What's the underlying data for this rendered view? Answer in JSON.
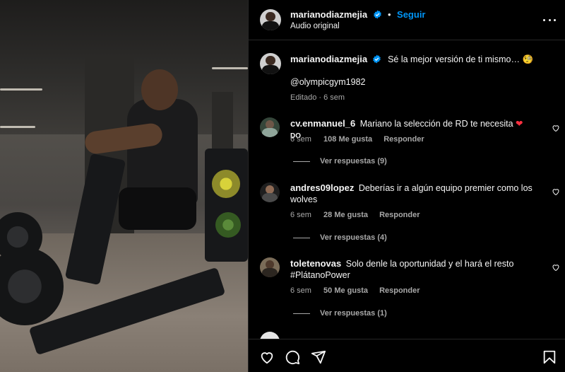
{
  "post": {
    "author": "marianodiazmejia",
    "follow_label": "Seguir",
    "separator": "•",
    "audio": "Audio original",
    "caption_author": "marianodiazmejia",
    "caption": "Sé la mejor versión de ti mismo…",
    "caption_emoji": "🧐",
    "mention": "@olympicgym1982",
    "edited": "Editado · 6 sem"
  },
  "comments": [
    {
      "user": "cv.enmanuel_6",
      "text": "Mariano la selección de RD te necesita",
      "text_suffix": "DO",
      "time": "6 sem",
      "likes": "108 Me gusta",
      "reply_label": "Responder",
      "view_replies": "Ver respuestas (9)"
    },
    {
      "user": "andres09lopez",
      "text": "Deberías ir a algún equipo premier como los wolves",
      "time": "6 sem",
      "likes": "28 Me gusta",
      "reply_label": "Responder",
      "view_replies": "Ver respuestas (4)"
    },
    {
      "user": "toletenovas",
      "text": "Solo denle la oportunidad y el hará el resto #PlátanoPower",
      "time": "6 sem",
      "likes": "50 Me gusta",
      "reply_label": "Responder",
      "view_replies": "Ver respuestas (1)"
    }
  ],
  "icons": {
    "verified": "verified-badge-icon",
    "more": "more-options-icon",
    "like": "heart-icon",
    "comment": "comment-icon",
    "share": "share-icon",
    "save": "bookmark-icon"
  },
  "colors": {
    "accent": "#0095f6",
    "background": "#000000",
    "muted": "#a8a8a8",
    "heart_red": "#ff3040"
  }
}
